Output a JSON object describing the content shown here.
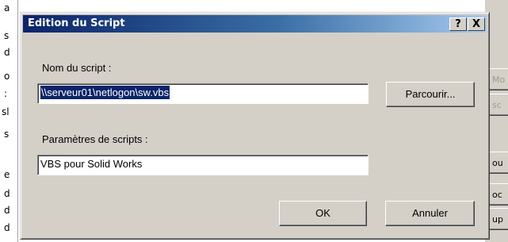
{
  "background": {
    "left_chars": [
      "a",
      "s",
      "d",
      "o",
      ":",
      "sl",
      "s",
      "e",
      "d",
      "d",
      "d"
    ],
    "right_buttons": [
      "Mo",
      "sc",
      "ou",
      "oc",
      "up"
    ]
  },
  "dialog": {
    "title": "Edition du Script",
    "help_glyph": "?",
    "close_glyph": "X",
    "script_name_label": "Nom du script :",
    "script_name_value": "\\\\serveur01\\netlogon\\sw.vbs",
    "browse_label": "Parcourir...",
    "script_params_label": "Paramètres de scripts :",
    "script_params_value": "VBS pour Solid Works",
    "ok_label": "OK",
    "cancel_label": "Annuler"
  }
}
